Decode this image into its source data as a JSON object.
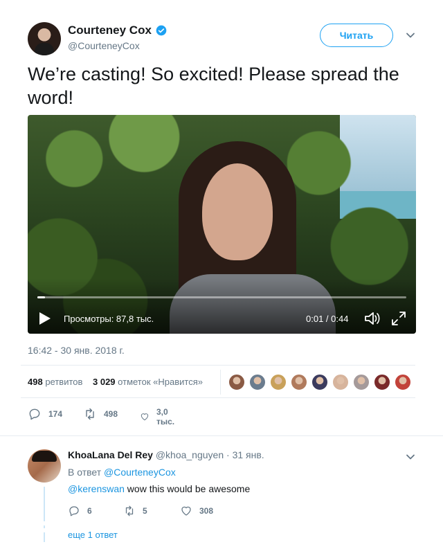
{
  "tweet": {
    "author": {
      "name": "Courteney Cox",
      "handle": "@CourteneyCox",
      "verified": true
    },
    "follow_label": "Читать",
    "text": "We’re casting! So excited! Please spread the word!",
    "video": {
      "views_label": "Просмотры: 87,8 тыс.",
      "time_label": "0:01 / 0:44",
      "progress_fraction": 0.02
    },
    "timestamp": "16:42 - 30 янв. 2018 г.",
    "stats": {
      "retweets_count": "498",
      "retweets_label": "ретвитов",
      "likes_count": "3 029",
      "likes_label": "отметок «Нравится»",
      "liker_colors": [
        "#8a5a44",
        "#6b7c8e",
        "#c9a15a",
        "#b07a5c",
        "#3b3b5e",
        "#d7b49c",
        "#a59a9a",
        "#7a2a2a",
        "#c2433a"
      ]
    },
    "actions": {
      "replies": "174",
      "retweets": "498",
      "likes": "3,0 тыс."
    }
  },
  "reply": {
    "name": "KhoaLana Del Rey",
    "handle": "@khoa_nguyen",
    "date": "· 31 янв.",
    "in_reply_prefix": "В ответ",
    "in_reply_handle": "@CourteneyCox",
    "mention": "@kerenswan",
    "text": " wow this would be awesome",
    "actions": {
      "replies": "6",
      "retweets": "5",
      "likes": "308"
    },
    "more_label": "еще 1 ответ"
  },
  "colors": {
    "accent": "#1da1f2",
    "link": "#1b95e0",
    "muted": "#657786",
    "text": "#14171a"
  }
}
